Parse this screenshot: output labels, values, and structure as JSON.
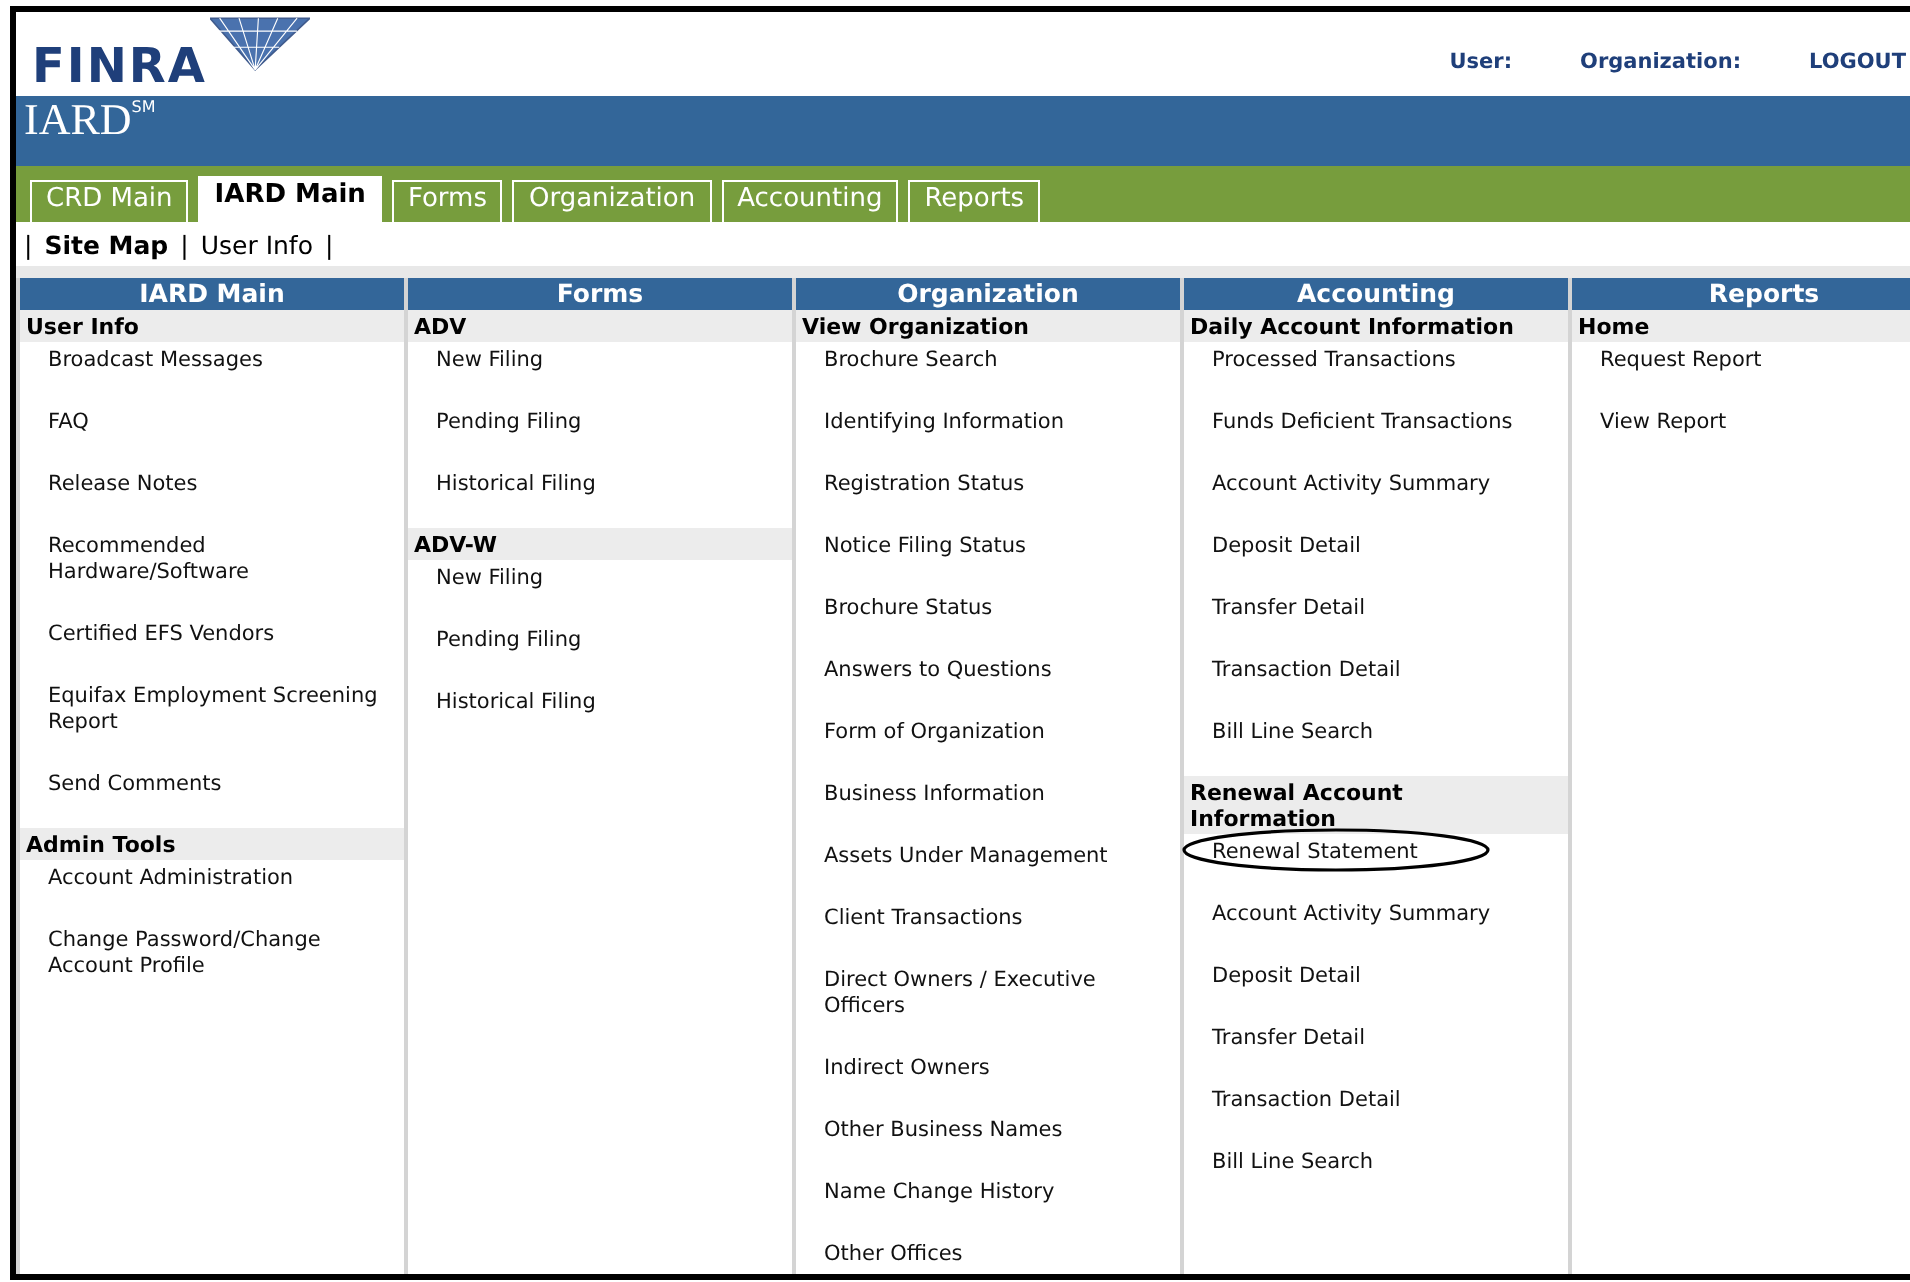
{
  "header": {
    "logo": "FINRA",
    "product": "IARD$^{SM}$",
    "links": [
      {
        "label": "User:"
      },
      {
        "label": "Organization:"
      },
      {
        "label": "LOGOUT"
      }
    ]
  },
  "tabs": [
    {
      "label": "CRD Main",
      "selected": false
    },
    {
      "label": "IARD Main",
      "selected": true
    },
    {
      "label": "Forms",
      "selected": false
    },
    {
      "label": "Organization",
      "selected": false
    },
    {
      "label": "Accounting",
      "selected": false
    },
    {
      "label": "Reports",
      "selected": false
    }
  ],
  "subnav": {
    "separator": "|",
    "items": [
      {
        "label": "Site Map",
        "selected": true
      },
      {
        "label": "User Info",
        "selected": false
      }
    ]
  },
  "columns": [
    {
      "title": "IARD Main",
      "sections": [
        {
          "heading": "User Info",
          "items": [
            {
              "label": "Broadcast Messages",
              "circled": false
            },
            {
              "label": "FAQ",
              "circled": false
            },
            {
              "label": "Release Notes",
              "circled": false
            },
            {
              "label": "Recommended Hardware/Software",
              "circled": false
            },
            {
              "label": "Certified EFS Vendors",
              "circled": false
            },
            {
              "label": "Equifax Employment Screening Report",
              "circled": false
            },
            {
              "label": "Send Comments",
              "circled": false
            }
          ]
        },
        {
          "heading": "Admin Tools",
          "items": [
            {
              "label": "Account Administration",
              "circled": false
            },
            {
              "label": "Change Password/Change Account Profile",
              "circled": false
            }
          ]
        }
      ]
    },
    {
      "title": "Forms",
      "sections": [
        {
          "heading": "ADV",
          "items": [
            {
              "label": "New Filing",
              "circled": false
            },
            {
              "label": "Pending Filing",
              "circled": false
            },
            {
              "label": "Historical Filing",
              "circled": false
            }
          ]
        },
        {
          "heading": "ADV-W",
          "items": [
            {
              "label": "New Filing",
              "circled": false
            },
            {
              "label": "Pending Filing",
              "circled": false
            },
            {
              "label": "Historical Filing",
              "circled": false
            }
          ]
        }
      ]
    },
    {
      "title": "Organization",
      "sections": [
        {
          "heading": "View Organization",
          "items": [
            {
              "label": "Brochure Search",
              "circled": false
            },
            {
              "label": "Identifying Information",
              "circled": false
            },
            {
              "label": "Registration Status",
              "circled": false
            },
            {
              "label": "Notice Filing Status",
              "circled": false
            },
            {
              "label": "Brochure Status",
              "circled": false
            },
            {
              "label": "Answers to Questions",
              "circled": false
            },
            {
              "label": "Form of Organization",
              "circled": false
            },
            {
              "label": "Business Information",
              "circled": false
            },
            {
              "label": "Assets Under Management",
              "circled": false
            },
            {
              "label": "Client Transactions",
              "circled": false
            },
            {
              "label": "Direct Owners / Executive Officers",
              "circled": false
            },
            {
              "label": "Indirect Owners",
              "circled": false
            },
            {
              "label": "Other Business Names",
              "circled": false
            },
            {
              "label": "Name Change History",
              "circled": false
            },
            {
              "label": "Other Offices",
              "circled": false
            }
          ]
        }
      ]
    },
    {
      "title": "Accounting",
      "sections": [
        {
          "heading": "Daily Account Information",
          "items": [
            {
              "label": "Processed Transactions",
              "circled": false
            },
            {
              "label": "Funds Deficient Transactions",
              "circled": false
            },
            {
              "label": "Account Activity Summary",
              "circled": false
            },
            {
              "label": "Deposit Detail",
              "circled": false
            },
            {
              "label": "Transfer Detail",
              "circled": false
            },
            {
              "label": "Transaction Detail",
              "circled": false
            },
            {
              "label": "Bill Line Search",
              "circled": false
            }
          ]
        },
        {
          "heading": "Renewal Account Information",
          "items": [
            {
              "label": "Renewal Statement",
              "circled": true
            },
            {
              "label": "Account Activity Summary",
              "circled": false
            },
            {
              "label": "Deposit Detail",
              "circled": false
            },
            {
              "label": "Transfer Detail",
              "circled": false
            },
            {
              "label": "Transaction Detail",
              "circled": false
            },
            {
              "label": "Bill Line Search",
              "circled": false
            }
          ]
        }
      ]
    },
    {
      "title": "Reports",
      "sections": [
        {
          "heading": "Home",
          "items": [
            {
              "label": "Request Report",
              "circled": false
            },
            {
              "label": "View Report",
              "circled": false
            }
          ]
        }
      ]
    }
  ]
}
